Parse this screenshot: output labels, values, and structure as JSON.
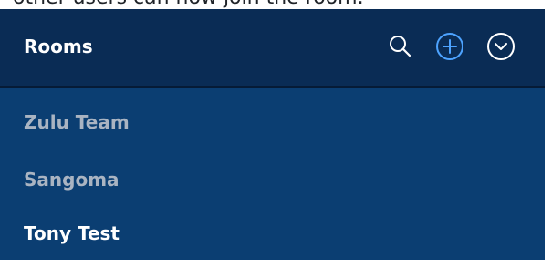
{
  "caption": "other users can now join the room.",
  "sidebar": {
    "title": "Rooms",
    "icons": {
      "search": "search-icon",
      "add": "plus-circle-icon",
      "menu": "chevron-down-circle-icon"
    },
    "rooms": [
      {
        "label": "Zulu Team",
        "state": "unread-muted"
      },
      {
        "label": "Sangoma",
        "state": "unread-muted"
      },
      {
        "label": "Tony Test",
        "state": "highlighted"
      }
    ]
  },
  "colors": {
    "header_bg": "#0a2c55",
    "panel_bg": "#0b3e72",
    "accent": "#4da3ff",
    "muted_text": "#aab4c2",
    "active_text": "#ffffff"
  }
}
